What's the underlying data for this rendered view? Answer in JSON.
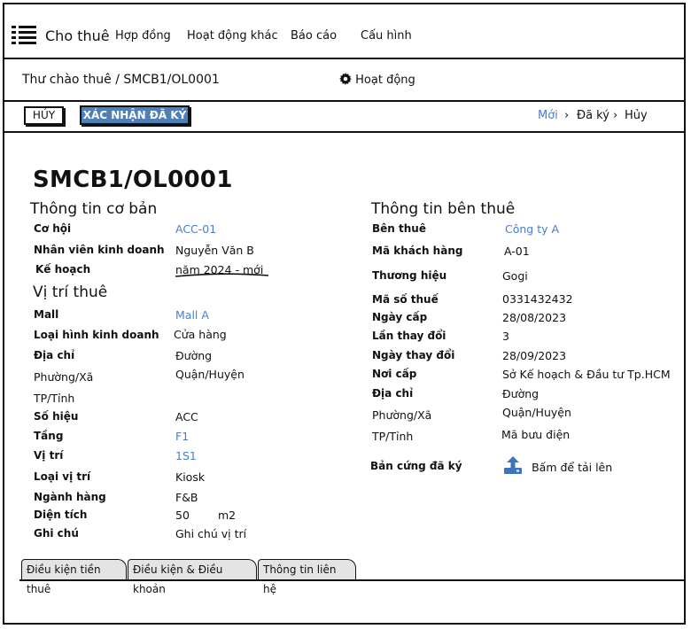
{
  "nav": {
    "app_title": "Cho thuê",
    "items": [
      "Hợp đồng",
      "Hoạt động khác",
      "Báo cáo",
      "Cấu hình"
    ]
  },
  "breadcrumb": "Thư chào thuê / SMCB1/OL0001",
  "activity": "Hoạt động",
  "actions": {
    "cancel": "HỦY",
    "confirm": "XÁC NHẬN ĐÃ KÝ"
  },
  "stages": [
    "Mới",
    "Đã ký",
    "Hủy"
  ],
  "record_title": "SMCB1/OL0001",
  "basic": {
    "heading": "Thông tin cơ bản",
    "rows": [
      {
        "label": "Cơ hội",
        "value": "ACC-01"
      },
      {
        "label": "Nhân viên kinh doanh",
        "value": "Nguyễn Văn B"
      },
      {
        "label": "Kế hoạch",
        "value": "năm 2024 - mới"
      }
    ]
  },
  "location": {
    "heading": "Vị trí thuê",
    "rows": [
      {
        "label": "Mall",
        "value": "Mall A"
      },
      {
        "label": "Loại hình kinh doanh",
        "value": "Cửa hàng"
      },
      {
        "label": "Địa chỉ",
        "value": "Đường"
      },
      {
        "label": "Phường/Xã",
        "value": "Quận/Huyện"
      },
      {
        "label": "TP/Tỉnh",
        "value": ""
      },
      {
        "label": "Số hiệu",
        "value": "ACC"
      },
      {
        "label": "Tầng",
        "value": "F1"
      },
      {
        "label": "Vị trí",
        "value": "1S1"
      },
      {
        "label": "Loại vị trí",
        "value": "Kiosk"
      },
      {
        "label": "Ngành hàng",
        "value": "F&B"
      },
      {
        "label": "Diện tích",
        "value": "50",
        "unit": "m2"
      },
      {
        "label": "Ghi chú",
        "value": "Ghi chú vị trí"
      }
    ]
  },
  "tenant": {
    "heading": "Thông tin bên thuê",
    "rows": [
      {
        "label": "Bên thuê",
        "value": "Công ty A"
      },
      {
        "label": "Mã khách hàng",
        "value": "A-01"
      },
      {
        "label": "Thương hiệu",
        "value": "Gogi"
      },
      {
        "label": "Mã số thuế",
        "value": "0331432432"
      },
      {
        "label": "Ngày cấp",
        "value": "28/08/2023"
      },
      {
        "label": "Lần thay đổi",
        "value": "3"
      },
      {
        "label": "Ngày thay đổi",
        "value": "28/09/2023"
      },
      {
        "label": "Nơi cấp",
        "value": "Sở Kế hoạch & Đầu tư Tp.HCM"
      },
      {
        "label": "Địa chỉ",
        "value": "Đường"
      },
      {
        "label": "Phường/Xã",
        "value": "Quận/Huyện"
      },
      {
        "label": "TP/Tỉnh",
        "value": "Mã bưu điện"
      }
    ],
    "upload_label": "Bản cứng đã ký",
    "upload_action": "Bấm để tải lên"
  },
  "tabs": [
    "Điều kiện tiền thuê",
    "Điều kiện & Điều khoản",
    "Thông tin liên hệ"
  ]
}
